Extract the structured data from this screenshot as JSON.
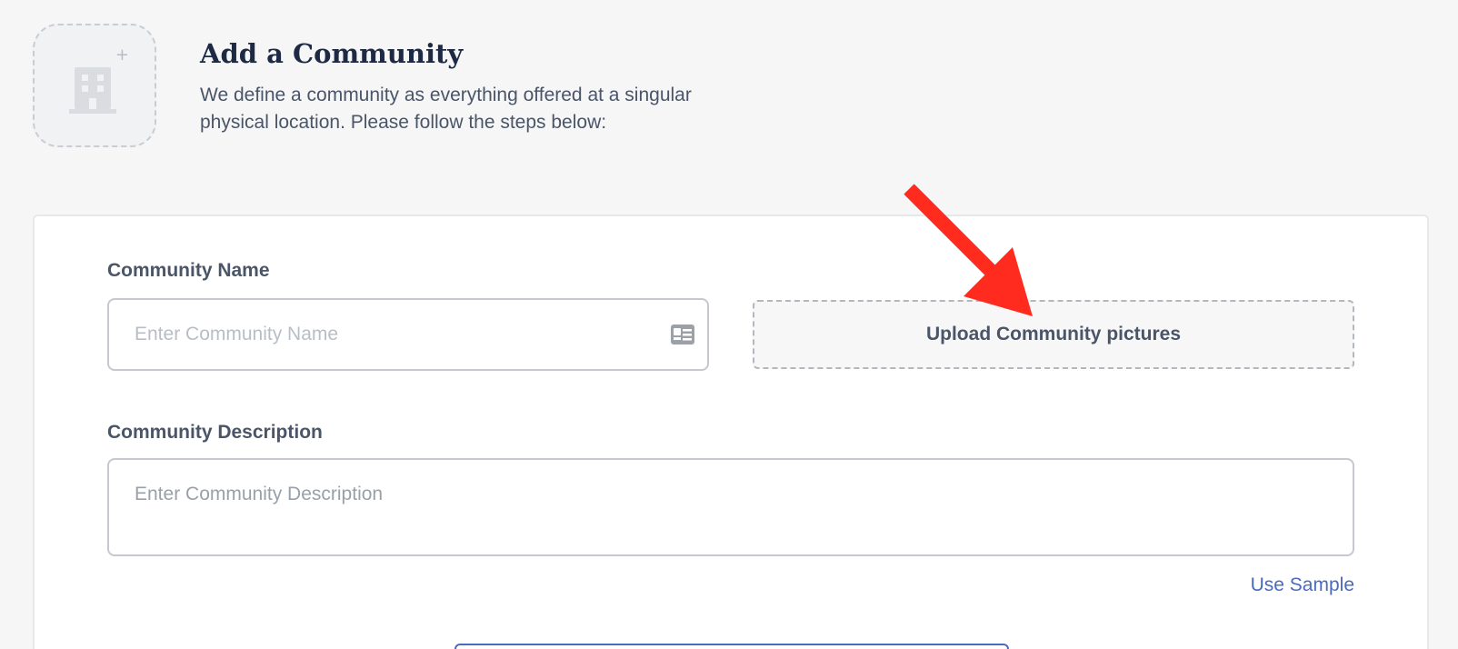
{
  "header": {
    "title": "Add a Community",
    "subtitle": "We define a community as everything offered at a singular physical location. Please follow the steps below:",
    "icon": "building-plus-icon"
  },
  "form": {
    "name_label": "Community Name",
    "name_placeholder": "Enter Community Name",
    "name_value": "",
    "name_icon": "id-card-icon",
    "upload_label": "Upload Community pictures",
    "description_label": "Community Description",
    "description_placeholder": "Enter Community Description",
    "description_value": "",
    "use_sample_label": "Use Sample"
  },
  "colors": {
    "accent": "#4a6bbd",
    "annotation_arrow": "#ff2b1f",
    "title": "#1e2a44"
  }
}
